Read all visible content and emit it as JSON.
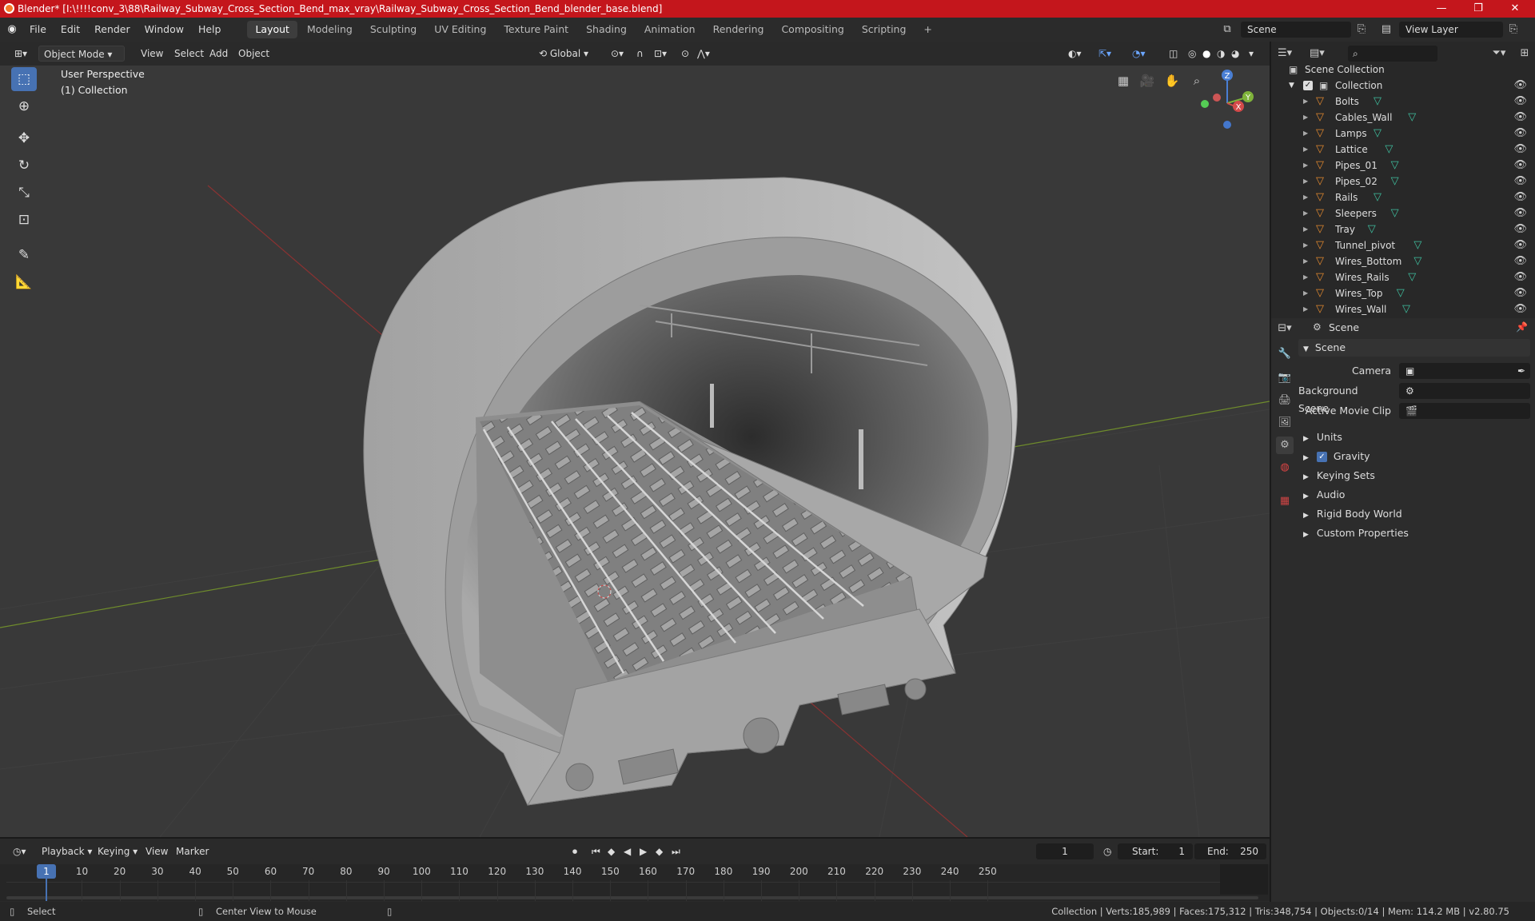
{
  "window": {
    "title": "Blender* [I:\\!!!!conv_3\\88\\Railway_Subway_Cross_Section_Bend_max_vray\\Railway_Subway_Cross_Section_Bend_blender_base.blend]",
    "minimize": "—",
    "maximize": "❐",
    "close": "✕"
  },
  "menubar": {
    "menus": [
      "File",
      "Edit",
      "Render",
      "Window",
      "Help"
    ],
    "workspaces": [
      "Layout",
      "Modeling",
      "Sculpting",
      "UV Editing",
      "Texture Paint",
      "Shading",
      "Animation",
      "Rendering",
      "Compositing",
      "Scripting"
    ],
    "active_workspace": "Layout",
    "add_tab": "+",
    "scene_label": "Scene",
    "view_layer_label": "View Layer"
  },
  "viewport_header": {
    "mode": "Object Mode",
    "menus": [
      "View",
      "Select",
      "Add",
      "Object"
    ],
    "orientation": "Global"
  },
  "viewport": {
    "perspective": "User Perspective",
    "collection": "(1) Collection",
    "gizmo_axes": [
      "X",
      "Y",
      "Z"
    ]
  },
  "outliner": {
    "scene_collection": "Scene Collection",
    "collection": "Collection",
    "objects": [
      "Bolts",
      "Cables_Wall",
      "Lamps",
      "Lattice",
      "Pipes_01",
      "Pipes_02",
      "Rails",
      "Sleepers",
      "Tray",
      "Tunnel_pivot",
      "Wires_Bottom",
      "Wires_Rails",
      "Wires_Top",
      "Wires_Wall"
    ]
  },
  "properties": {
    "context": "Scene",
    "panel_title": "Scene",
    "camera_label": "Camera",
    "background_scene_label": "Background Scene",
    "active_movie_clip_label": "Active Movie Clip",
    "sections": [
      "Units",
      "Gravity",
      "Keying Sets",
      "Audio",
      "Rigid Body World",
      "Custom Properties"
    ],
    "gravity_checked": true
  },
  "timeline": {
    "menus": [
      "Playback",
      "Keying",
      "View",
      "Marker"
    ],
    "current_frame": "1",
    "start_label": "Start:",
    "start_value": "1",
    "end_label": "End:",
    "end_value": "250",
    "ticks": [
      "1",
      "10",
      "20",
      "30",
      "40",
      "50",
      "60",
      "70",
      "80",
      "90",
      "100",
      "110",
      "120",
      "130",
      "140",
      "150",
      "160",
      "170",
      "180",
      "190",
      "200",
      "210",
      "220",
      "230",
      "240",
      "250"
    ]
  },
  "statusbar": {
    "select": "Select",
    "center_view": "Center View to Mouse",
    "stats": "Collection | Verts:185,989 | Faces:175,312 | Tris:348,754 | Objects:0/14 | Mem: 114.2 MB | v2.80.75"
  },
  "colors": {
    "title_bar": "#c4161c",
    "accent": "#4772b3",
    "object_icon": "#e58a2f",
    "mesh_icon": "#3fc1a0"
  }
}
